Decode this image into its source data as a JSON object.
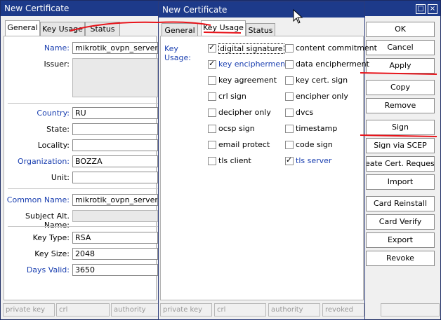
{
  "back_window": {
    "title": "New Certificate",
    "tabs": [
      {
        "label": "General"
      },
      {
        "label": "Key Usage"
      },
      {
        "label": "Status"
      }
    ],
    "fields": {
      "name": {
        "label": "Name:",
        "value": "mikrotik_ovpn_server"
      },
      "issuer": {
        "label": "Issuer:",
        "value": ""
      },
      "country": {
        "label": "Country:",
        "value": "RU"
      },
      "state": {
        "label": "State:",
        "value": ""
      },
      "locality": {
        "label": "Locality:",
        "value": ""
      },
      "organization": {
        "label": "Organization:",
        "value": "BOZZA"
      },
      "unit": {
        "label": "Unit:",
        "value": ""
      },
      "common_name": {
        "label": "Common Name:",
        "value": "mikrotik_ovpn_server"
      },
      "subject_alt_name": {
        "label": "Subject Alt. Name:",
        "value": ""
      },
      "key_type": {
        "label": "Key Type:",
        "value": "RSA"
      },
      "key_size": {
        "label": "Key Size:",
        "value": "2048"
      },
      "days_valid": {
        "label": "Days Valid:",
        "value": "3650"
      }
    },
    "status_bar": [
      "private key",
      "crl",
      "authority"
    ],
    "buttons": [
      "OK",
      "Cancel",
      "Apply",
      "Copy",
      "Remove",
      "Sign",
      "Sign via SCEP",
      "Create Cert. Request",
      "Import",
      "Card Reinstall",
      "Card Verify",
      "Export",
      "Revoke"
    ],
    "controls": {
      "restore": "□",
      "close": "×"
    }
  },
  "front_window": {
    "title": "New Certificate",
    "tabs": [
      {
        "label": "General"
      },
      {
        "label": "Key Usage"
      },
      {
        "label": "Status"
      }
    ],
    "key_usage_label": "Key Usage:",
    "checkboxes_left": [
      {
        "label": "digital signature",
        "checked": true
      },
      {
        "label": "key encipherment",
        "checked": true
      },
      {
        "label": "key agreement",
        "checked": false
      },
      {
        "label": "crl sign",
        "checked": false
      },
      {
        "label": "decipher only",
        "checked": false
      },
      {
        "label": "ocsp sign",
        "checked": false
      },
      {
        "label": "email protect",
        "checked": false
      },
      {
        "label": "tls client",
        "checked": false
      }
    ],
    "checkboxes_right": [
      {
        "label": "content commitment",
        "checked": false
      },
      {
        "label": "data encipherment",
        "checked": false
      },
      {
        "label": "key cert. sign",
        "checked": false
      },
      {
        "label": "encipher only",
        "checked": false
      },
      {
        "label": "dvcs",
        "checked": false
      },
      {
        "label": "timestamp",
        "checked": false
      },
      {
        "label": "code sign",
        "checked": false
      },
      {
        "label": "tls server",
        "checked": true
      }
    ],
    "status_bar": [
      "private key",
      "crl",
      "authority",
      "revoked"
    ]
  },
  "annotation_color": "#e8141b"
}
